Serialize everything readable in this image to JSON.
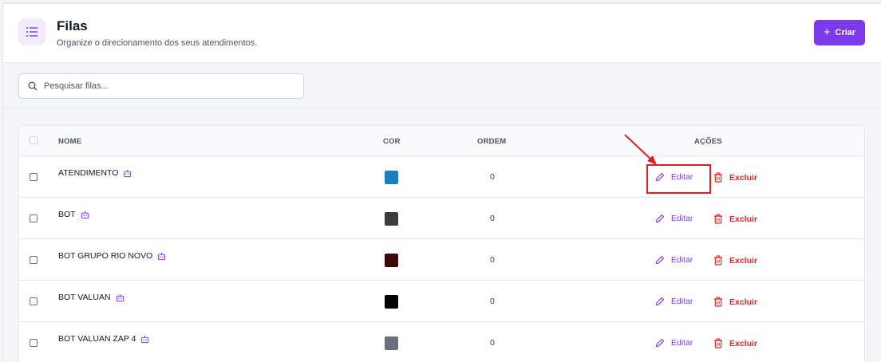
{
  "header": {
    "title": "Filas",
    "subtitle": "Organize o direcionamento dos seus atendimentos.",
    "create_label": "Criar"
  },
  "search": {
    "placeholder": "Pesquisar filas..."
  },
  "table": {
    "columns": {
      "name": "NOME",
      "color": "COR",
      "order": "ORDEM",
      "actions": "AÇÕES"
    },
    "rows": [
      {
        "name": "ATENDIMENTO",
        "color": "#1a7fc0",
        "order": "0",
        "edit": "Editar",
        "delete": "Excluir"
      },
      {
        "name": "BOT",
        "color": "#3d3d3d",
        "order": "0",
        "edit": "Editar",
        "delete": "Excluir"
      },
      {
        "name": "BOT GRUPO RIO NOVO",
        "color": "#3d0808",
        "order": "0",
        "edit": "Editar",
        "delete": "Excluir"
      },
      {
        "name": "BOT VALUAN",
        "color": "#000000",
        "order": "0",
        "edit": "Editar",
        "delete": "Excluir"
      },
      {
        "name": "BOT VALUAN ZAP 4",
        "color": "#6b6f7b",
        "order": "0",
        "edit": "Editar",
        "delete": "Excluir"
      }
    ]
  },
  "colors": {
    "accent": "#7c3aed",
    "danger": "#dc2626",
    "annotation": "#e11d1d"
  }
}
